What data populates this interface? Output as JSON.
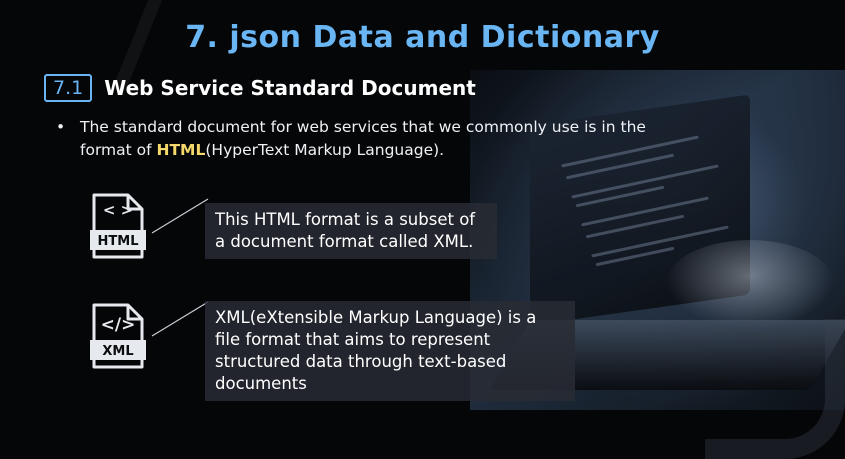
{
  "slide": {
    "title": "7. json Data and Dictionary",
    "section": {
      "number": "7.1",
      "title": "Web Service Standard Document"
    },
    "bullet": {
      "marker": "•",
      "text_before": "The standard document for web services that we commonly use is in the format of ",
      "highlight": "HTML",
      "text_after": "(HyperText Markup Language)."
    },
    "items": [
      {
        "icon_symbol": "< >",
        "icon_label": "HTML",
        "icon_name": "html-file-icon",
        "text": "This HTML format is a subset of a document format called XML."
      },
      {
        "icon_symbol": "</>",
        "icon_label": "XML",
        "icon_name": "xml-file-icon",
        "text": "XML(eXtensible Markup Language) is a file format that aims to represent structured data through text-based documents"
      }
    ]
  },
  "colors": {
    "accent": "#6ab6f5",
    "highlight": "#f5d86a",
    "background": "#050608",
    "callout_bg": "#282c34"
  }
}
